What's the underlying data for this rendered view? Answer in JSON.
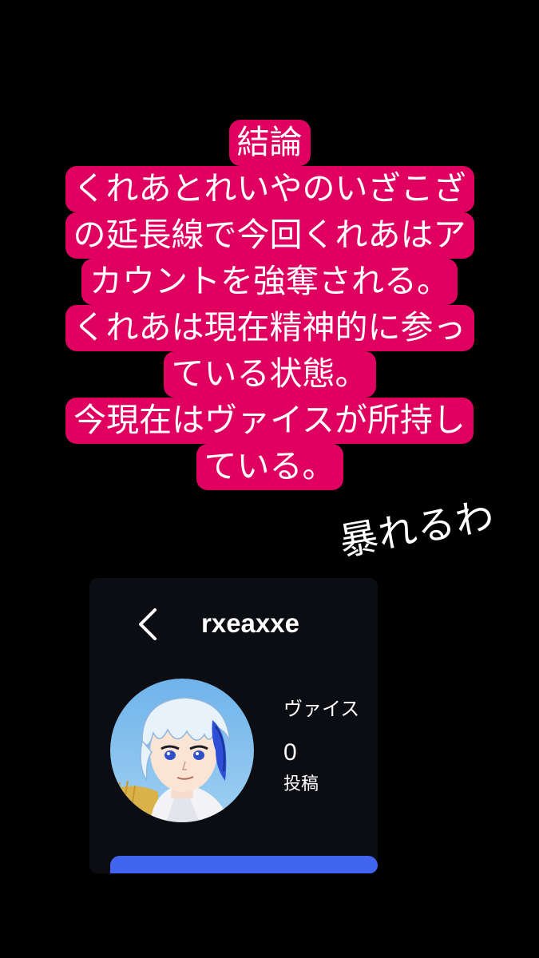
{
  "caption": {
    "lines": [
      "結論",
      "くれあとれいやのいざこざ",
      "の延長線で今回くれあはア",
      "カウントを強奪される。",
      "くれあは現在精神的に参っ",
      "ている状態。",
      "今現在はヴァイスが所持し",
      "ている。"
    ],
    "highlight_color": "#e0005f"
  },
  "sticker_text": "暴れるわ",
  "profile": {
    "username": "rxeaxxe",
    "display_name": "ヴァイス",
    "post_count": "0",
    "post_label": "投稿",
    "back_icon": "chevron-left-icon",
    "accent_color": "#4165f0"
  }
}
